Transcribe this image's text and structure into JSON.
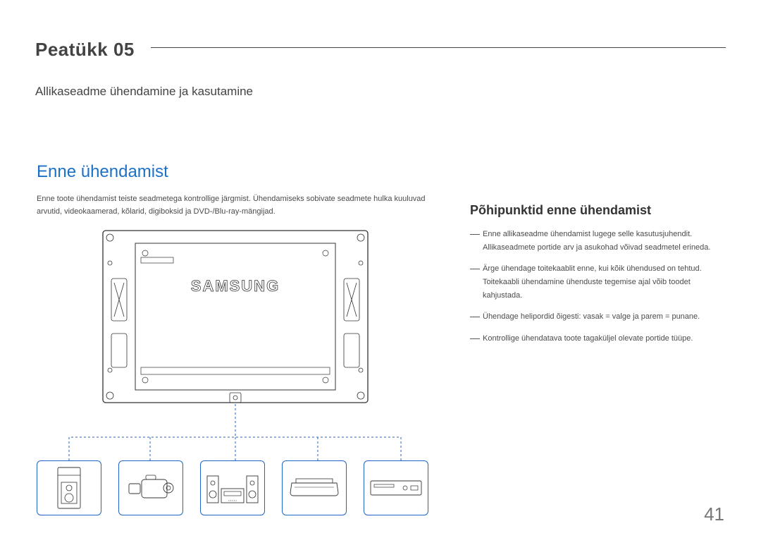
{
  "header": {
    "chapter_label": "Peatükk  05",
    "sub_label": "Allikaseadme ühendamine ja kasutamine"
  },
  "left": {
    "title": "Enne ühendamist",
    "intro": "Enne toote ühendamist teiste seadmetega kontrollige järgmist. Ühendamiseks sobivate seadmete hulka kuuluvad arvutid, videokaamerad, kõlarid, digiboksid ja DVD-/Blu-ray-mängijad.",
    "panel_brand": "SAMSUNG"
  },
  "right": {
    "subtitle": "Põhipunktid enne ühendamist",
    "items": [
      "Enne allikaseadme ühendamist lugege selle kasutusjuhendit. Allikaseadmete portide arv ja asukohad võivad seadmetel erineda.",
      "Ärge ühendage toitekaablit enne, kui kõik ühendused on tehtud. Toitekaabli ühendamine ühenduste tegemise ajal võib toodet kahjustada.",
      "Ühendage helipordid õigesti: vasak = valge ja parem = punane.",
      "Kontrollige ühendatava toote tagaküljel olevate portide tüüpe."
    ]
  },
  "page_number": "41",
  "devices": [
    "speaker",
    "camcorder",
    "hifi",
    "settop",
    "dvd"
  ]
}
